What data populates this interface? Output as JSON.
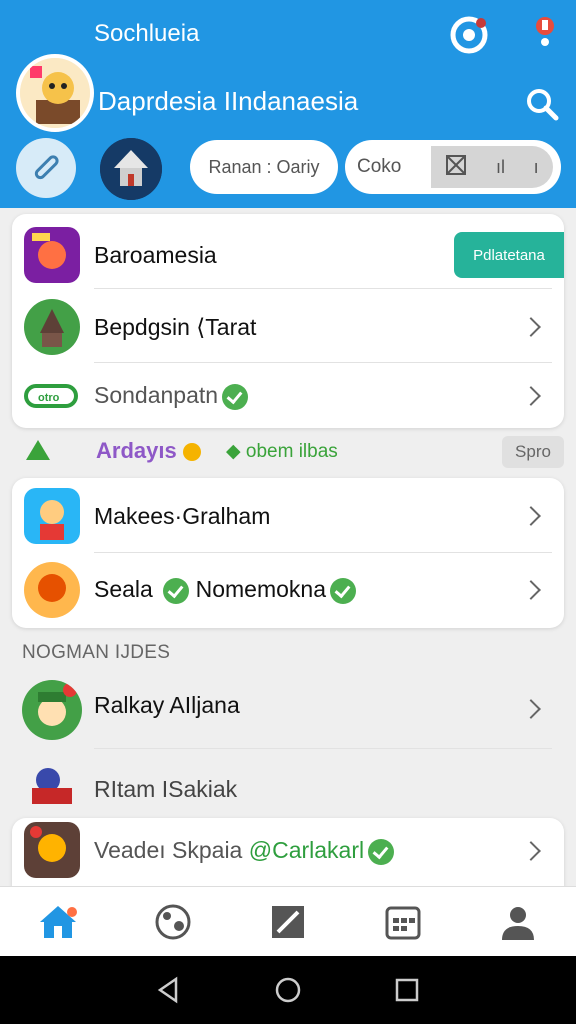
{
  "header": {
    "app_title": "Sochlueia",
    "subtitle": "Daprdesia IIndanaesia",
    "chip_a": "Ranan : Oariy",
    "chip_b": "Coko",
    "chip_b_action_2": "ıl",
    "chip_b_action_3": "ı"
  },
  "card1": {
    "row1": {
      "label": "Baroamesia",
      "badge": "Pdlatetana"
    },
    "row2": {
      "label": "Bepdgsin ⟨Tarat"
    },
    "row3": {
      "label": "Sondanpatn"
    }
  },
  "card1_row3_icon_text": "otro",
  "strip": {
    "left_text": "Ardayıs",
    "right_text": "obem ilbas",
    "button": "Spro"
  },
  "card2": {
    "row1": {
      "label": "Makees·Gralham"
    },
    "row2": {
      "label_a": "Seala",
      "label_b": "Nomemokna"
    }
  },
  "section": {
    "heading": "NOGMAN IJDES"
  },
  "list": {
    "row1": {
      "label": "Ralkay AIljana"
    },
    "row2": {
      "label": "RItam ISakiak"
    },
    "row3": {
      "label_a": "Veadeı Skpaia",
      "label_b": "@Carlakarl"
    }
  },
  "colors": {
    "header_bg": "#2196e3",
    "accent_teal": "#26b39a",
    "accent_green": "#4caf50",
    "strip_purple": "#8e58c7",
    "nav_active": "#2196e3"
  },
  "icons": [
    "settings-ring-icon",
    "notification-icon",
    "search-icon",
    "edit-pencil-icon",
    "chevron-right-icon",
    "home-icon",
    "globe-icon",
    "edit-icon",
    "calendar-icon",
    "profile-icon",
    "back-icon",
    "home-circle-icon",
    "recents-icon"
  ]
}
